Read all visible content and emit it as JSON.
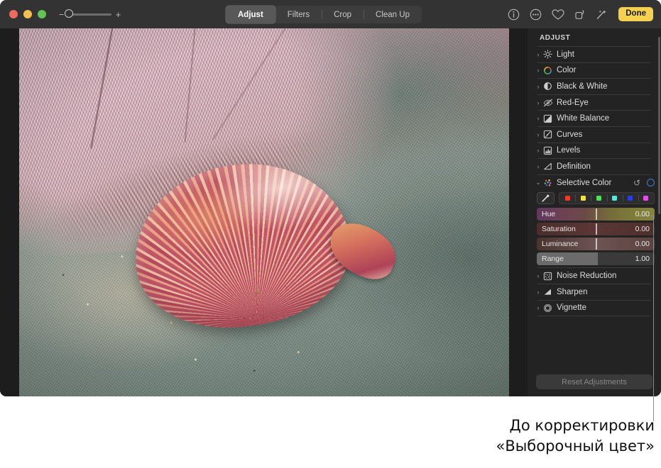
{
  "window": {
    "traffic_lights": [
      "close",
      "minimize",
      "maximize"
    ],
    "zoom": {
      "minus": "−",
      "plus": "+"
    }
  },
  "toolbar": {
    "tabs": [
      {
        "label": "Adjust",
        "active": true
      },
      {
        "label": "Filters",
        "active": false
      },
      {
        "label": "Crop",
        "active": false
      },
      {
        "label": "Clean Up",
        "active": false
      }
    ],
    "icons": [
      {
        "name": "info-icon",
        "glyph": "ⓘ"
      },
      {
        "name": "more-options-icon",
        "glyph": "···"
      },
      {
        "name": "favorite-heart-icon",
        "glyph": "♡"
      },
      {
        "name": "rotate-icon",
        "glyph": "↻"
      },
      {
        "name": "auto-enhance-wand-icon",
        "glyph": "✦"
      }
    ],
    "done_label": "Done",
    "done_color": "#f5d14f"
  },
  "sidebar": {
    "title": "ADJUST",
    "items": [
      {
        "label": "Light",
        "icon": "brightness-icon",
        "expanded": false
      },
      {
        "label": "Color",
        "icon": "color-wheel-icon",
        "expanded": false
      },
      {
        "label": "Black & White",
        "icon": "contrast-circle-icon",
        "expanded": false
      },
      {
        "label": "Red-Eye",
        "icon": "eye-slash-icon",
        "expanded": false
      },
      {
        "label": "White Balance",
        "icon": "white-balance-icon",
        "expanded": false
      },
      {
        "label": "Curves",
        "icon": "curves-icon",
        "expanded": false
      },
      {
        "label": "Levels",
        "icon": "levels-icon",
        "expanded": false
      },
      {
        "label": "Definition",
        "icon": "definition-triangle-icon",
        "expanded": false
      }
    ],
    "selective_color": {
      "label": "Selective Color",
      "icon": "selective-color-dots-icon",
      "expanded": true,
      "reset_icon": "reset-arrow-icon",
      "toggle_icon": "enable-toggle-ring-icon",
      "toggle_color": "#3c7fe0",
      "eyedropper_icon": "eyedropper-icon",
      "swatches": [
        {
          "name": "red",
          "color": "#f0392a"
        },
        {
          "name": "yellow",
          "color": "#f2e23c"
        },
        {
          "name": "green",
          "color": "#4ee05a"
        },
        {
          "name": "cyan",
          "color": "#55e8e2"
        },
        {
          "name": "blue",
          "color": "#2a3ce8"
        },
        {
          "name": "magenta",
          "color": "#e84ce8"
        }
      ],
      "sliders": [
        {
          "label": "Hue",
          "value": "0.00"
        },
        {
          "label": "Saturation",
          "value": "0.00"
        },
        {
          "label": "Luminance",
          "value": "0.00"
        },
        {
          "label": "Range",
          "value": "1.00"
        }
      ]
    },
    "items_bottom": [
      {
        "label": "Noise Reduction",
        "icon": "noise-reduction-icon",
        "expanded": false
      },
      {
        "label": "Sharpen",
        "icon": "sharpen-icon",
        "expanded": false
      },
      {
        "label": "Vignette",
        "icon": "vignette-icon",
        "expanded": false
      }
    ],
    "reset_button_label": "Reset Adjustments"
  },
  "photo": {
    "alt": "scallop-shell-on-towel"
  },
  "caption": {
    "line1": "До корректировки",
    "line2": "«Выборочный цвет»"
  }
}
